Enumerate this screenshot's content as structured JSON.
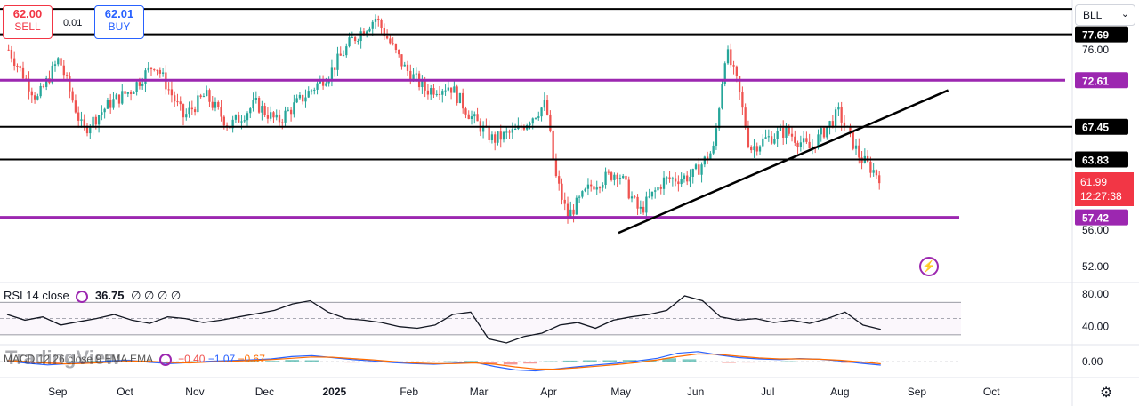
{
  "header": {
    "sell": {
      "price": "62.00",
      "label": "SELL"
    },
    "buy": {
      "price": "62.01",
      "label": "BUY"
    },
    "spread": "0.01",
    "symbol": "BLL"
  },
  "current_price": {
    "value": "61.99",
    "countdown": "12:27:38"
  },
  "watermark": "TradingView",
  "indicators": {
    "rsi": {
      "label": "RSI 14 close",
      "value": "36.75",
      "extra": "∅ ∅ ∅ ∅"
    },
    "macd": {
      "label": "MACD 12 26 close 9 EMA EMA",
      "hist": "−0.40",
      "macd": "−1.07",
      "signal": "−0.67"
    }
  },
  "colors": {
    "sell": "#f23645",
    "buy": "#2962ff",
    "up": "#26a69a",
    "down": "#ef5350",
    "purple": "#9c27b0",
    "black": "#000000",
    "rsi": "#131722",
    "macd_line": "#2962ff",
    "signal_line": "#ff6d00"
  },
  "chart_data": [
    {
      "type": "candlestick",
      "title": "BLL",
      "x_ticks": [
        "Sep",
        "Oct",
        "Nov",
        "Dec",
        "2025",
        "Feb",
        "Mar",
        "Apr",
        "May",
        "Jun",
        "Jul",
        "Aug",
        "Sep",
        "Oct"
      ],
      "y_ticks": [
        52.0,
        56.0,
        76.0
      ],
      "ylim": [
        50.5,
        81.0
      ],
      "horizontal_levels": [
        {
          "value": 80.5,
          "color": "#000000"
        },
        {
          "value": 77.69,
          "color": "#000000",
          "label": "77.69"
        },
        {
          "value": 72.61,
          "color": "#9c27b0",
          "label": "72.61"
        },
        {
          "value": 67.45,
          "color": "#000000",
          "label": "67.45"
        },
        {
          "value": 63.83,
          "color": "#000000",
          "label": "63.83"
        },
        {
          "value": 57.42,
          "color": "#9c27b0",
          "label": "57.42"
        }
      ],
      "trendline": {
        "from": {
          "date": "2025-05-01",
          "value": 55.7
        },
        "to": {
          "date": "2025-09-15",
          "value": 71.5
        }
      },
      "series": [
        {
          "name": "BLL",
          "ohlc_approx": [
            {
              "date": "2024-08-20",
              "close": 76.0
            },
            {
              "date": "2024-09-01",
              "close": 70.5
            },
            {
              "date": "2024-09-10",
              "close": 75.0
            },
            {
              "date": "2024-09-20",
              "close": 67.0
            },
            {
              "date": "2024-10-01",
              "close": 70.0
            },
            {
              "date": "2024-10-10",
              "close": 71.5
            },
            {
              "date": "2024-10-20",
              "close": 74.5
            },
            {
              "date": "2024-11-01",
              "close": 68.5
            },
            {
              "date": "2024-11-10",
              "close": 71.0
            },
            {
              "date": "2024-11-20",
              "close": 67.5
            },
            {
              "date": "2024-12-01",
              "close": 70.0
            },
            {
              "date": "2024-12-10",
              "close": 68.0
            },
            {
              "date": "2024-12-20",
              "close": 70.5
            },
            {
              "date": "2025-01-01",
              "close": 73.5
            },
            {
              "date": "2025-01-10",
              "close": 77.0
            },
            {
              "date": "2025-01-20",
              "close": 79.5
            },
            {
              "date": "2025-02-01",
              "close": 74.0
            },
            {
              "date": "2025-02-10",
              "close": 71.5
            },
            {
              "date": "2025-02-20",
              "close": 72.0
            },
            {
              "date": "2025-03-01",
              "close": 68.5
            },
            {
              "date": "2025-03-10",
              "close": 66.0
            },
            {
              "date": "2025-03-20",
              "close": 67.0
            },
            {
              "date": "2025-04-01",
              "close": 70.0
            },
            {
              "date": "2025-04-05",
              "close": 62.0
            },
            {
              "date": "2025-04-10",
              "close": 57.5
            },
            {
              "date": "2025-04-20",
              "close": 61.0
            },
            {
              "date": "2025-05-01",
              "close": 62.5
            },
            {
              "date": "2025-05-10",
              "close": 58.0
            },
            {
              "date": "2025-05-20",
              "close": 61.5
            },
            {
              "date": "2025-06-01",
              "close": 62.0
            },
            {
              "date": "2025-06-10",
              "close": 65.0
            },
            {
              "date": "2025-06-15",
              "close": 76.0
            },
            {
              "date": "2025-06-20",
              "close": 72.0
            },
            {
              "date": "2025-06-25",
              "close": 65.0
            },
            {
              "date": "2025-07-01",
              "close": 66.0
            },
            {
              "date": "2025-07-10",
              "close": 67.0
            },
            {
              "date": "2025-07-20",
              "close": 65.0
            },
            {
              "date": "2025-08-01",
              "close": 69.0
            },
            {
              "date": "2025-08-10",
              "close": 64.0
            },
            {
              "date": "2025-08-18",
              "close": 61.99
            }
          ]
        }
      ]
    },
    {
      "type": "line",
      "title": "RSI 14 close",
      "y_ticks": [
        80.0,
        40.0
      ],
      "bands": [
        70,
        30
      ],
      "ylim": [
        20,
        90
      ],
      "series": [
        {
          "name": "RSI",
          "values": [
            55,
            48,
            52,
            42,
            46,
            50,
            55,
            48,
            44,
            52,
            50,
            45,
            48,
            52,
            56,
            60,
            68,
            72,
            58,
            50,
            48,
            45,
            40,
            38,
            42,
            55,
            58,
            25,
            20,
            28,
            32,
            42,
            45,
            38,
            48,
            52,
            55,
            60,
            78,
            72,
            52,
            48,
            50,
            45,
            48,
            44,
            50,
            58,
            42,
            36.75
          ]
        }
      ]
    },
    {
      "type": "line",
      "title": "MACD 12 26 close 9 EMA EMA",
      "y_ticks": [
        0.0
      ],
      "ylim": [
        -4,
        4
      ],
      "series": [
        {
          "name": "MACD",
          "values": [
            0.2,
            -0.5,
            -1.0,
            -0.6,
            -0.3,
            0.2,
            0.4,
            -0.2,
            -0.6,
            -0.3,
            0.1,
            0.3,
            0.5,
            0.8,
            1.5,
            1.8,
            1.2,
            0.6,
            0.2,
            -0.3,
            -0.6,
            -0.8,
            -0.5,
            -0.2,
            -1.5,
            -2.5,
            -2.8,
            -2.2,
            -1.6,
            -1.0,
            -0.5,
            0.2,
            1.0,
            2.5,
            3.0,
            2.0,
            1.2,
            0.8,
            0.6,
            0.9,
            0.7,
            0.2,
            -0.5,
            -1.07
          ]
        },
        {
          "name": "Signal",
          "values": [
            0.3,
            0.0,
            -0.5,
            -0.7,
            -0.5,
            -0.2,
            0.2,
            0.1,
            -0.3,
            -0.4,
            -0.1,
            0.1,
            0.3,
            0.6,
            1.0,
            1.4,
            1.3,
            0.9,
            0.5,
            0.0,
            -0.4,
            -0.6,
            -0.6,
            -0.4,
            -0.8,
            -1.6,
            -2.2,
            -2.3,
            -1.9,
            -1.4,
            -0.9,
            -0.3,
            0.5,
            1.5,
            2.3,
            2.2,
            1.6,
            1.1,
            0.8,
            0.8,
            0.7,
            0.4,
            -0.1,
            -0.67
          ]
        }
      ],
      "histogram": [
        -0.1,
        -0.5,
        -0.5,
        0.1,
        0.2,
        0.4,
        0.2,
        -0.3,
        -0.3,
        0.1,
        0.2,
        0.2,
        0.2,
        0.2,
        0.5,
        0.4,
        -0.1,
        -0.3,
        -0.3,
        -0.3,
        -0.2,
        -0.2,
        0.1,
        0.2,
        -0.7,
        -0.9,
        -0.6,
        0.1,
        0.3,
        0.4,
        0.4,
        0.5,
        0.5,
        1.0,
        0.7,
        -0.2,
        -0.4,
        -0.3,
        -0.2,
        0.1,
        0.0,
        -0.2,
        -0.4,
        -0.4
      ]
    }
  ]
}
